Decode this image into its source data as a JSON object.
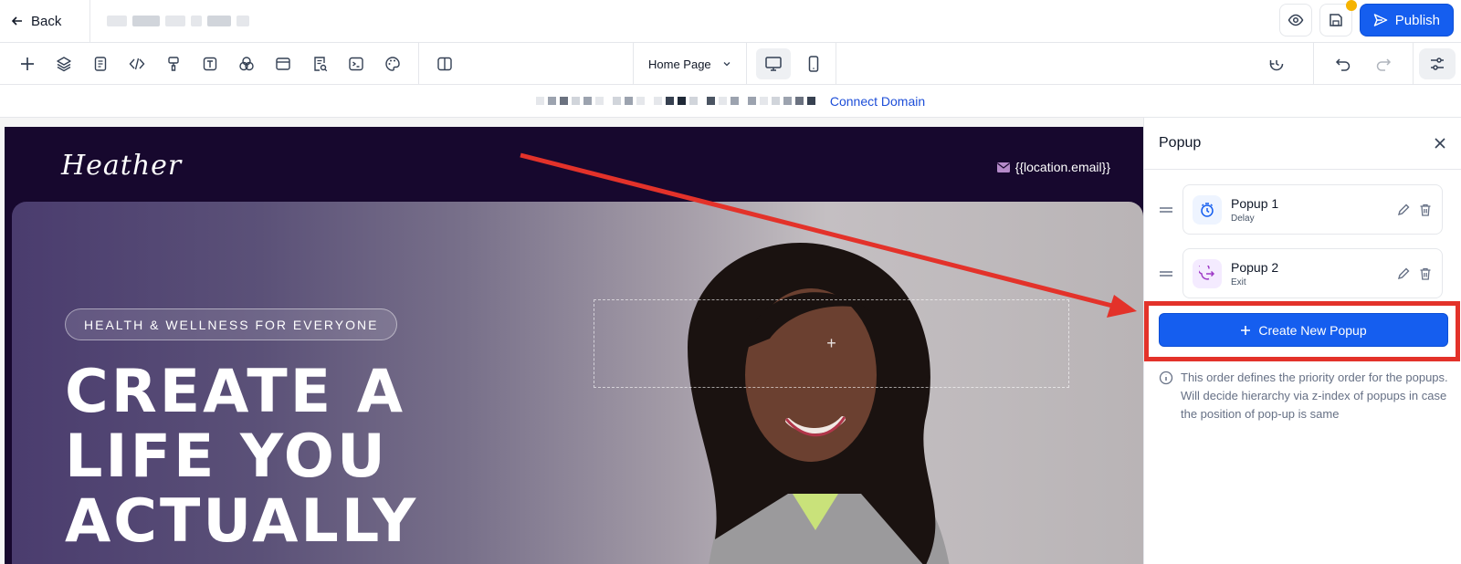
{
  "topbar": {
    "back_label": "Back",
    "publish_label": "Publish"
  },
  "toolbar": {
    "page_select": "Home Page"
  },
  "domainbar": {
    "connect_label": "Connect Domain"
  },
  "hero": {
    "logo_text": "Heather",
    "email_text": "{{location.email}}",
    "tagline": "HEALTH & WELLNESS FOR EVERYONE",
    "headline": [
      "CREATE A",
      "LIFE YOU",
      "ACTUALLY"
    ],
    "dropzone_plus": "+"
  },
  "panel": {
    "title": "Popup",
    "popups": [
      {
        "name": "Popup 1",
        "trigger": "Delay",
        "icon": "timer-icon"
      },
      {
        "name": "Popup 2",
        "trigger": "Exit",
        "icon": "exit-icon"
      }
    ],
    "create_label": "Create New Popup",
    "info_text": "This order defines the priority order for the popups. Will decide hierarchy via z-index of popups in case the position of pop-up is same"
  },
  "colors": {
    "primary": "#155eef",
    "annotation_red": "#e3322a",
    "hero_bg": "#17082e"
  }
}
